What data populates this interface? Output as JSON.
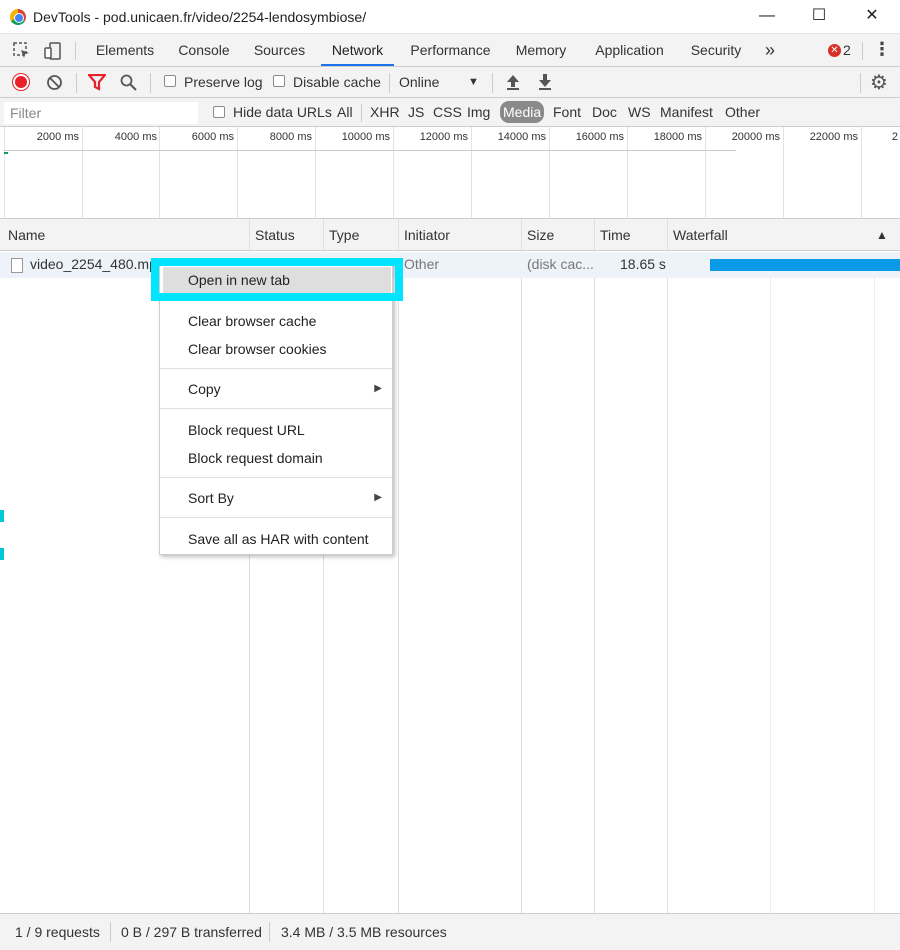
{
  "window": {
    "title": "DevTools - pod.unicaen.fr/video/2254-lendosymbiose/",
    "minimize_glyph": "—",
    "maximize_glyph": "☐",
    "close_glyph": "✕"
  },
  "tabs": {
    "items": [
      "Elements",
      "Console",
      "Sources",
      "Network",
      "Performance",
      "Memory",
      "Application",
      "Security"
    ],
    "active": "Network",
    "more_glyph": "»",
    "error_count": "2"
  },
  "toolbar": {
    "preserve_log": "Preserve log",
    "disable_cache": "Disable cache",
    "throttle": "Online",
    "throttle_arrow": "▼"
  },
  "filterbar": {
    "placeholder": "Filter",
    "hide_data_urls": "Hide data URLs",
    "types": [
      "All",
      "XHR",
      "JS",
      "CSS",
      "Img",
      "Media",
      "Font",
      "Doc",
      "WS",
      "Manifest",
      "Other"
    ],
    "active_type": "Media"
  },
  "overview": {
    "ticks": [
      "2000 ms",
      "4000 ms",
      "6000 ms",
      "8000 ms",
      "10000 ms",
      "12000 ms",
      "14000 ms",
      "16000 ms",
      "18000 ms",
      "20000 ms",
      "22000 ms",
      "2"
    ]
  },
  "table": {
    "columns": [
      "Name",
      "Status",
      "Type",
      "Initiator",
      "Size",
      "Time",
      "Waterfall"
    ],
    "sort_glyph": "▲",
    "rows": [
      {
        "name": "video_2254_480.mp",
        "initiator": "Other",
        "size": "(disk cac...",
        "time": "18.65 s"
      }
    ]
  },
  "context_menu": {
    "open_new_tab": "Open in new tab",
    "clear_cache": "Clear browser cache",
    "clear_cookies": "Clear browser cookies",
    "copy": "Copy",
    "block_url": "Block request URL",
    "block_domain": "Block request domain",
    "sort_by": "Sort By",
    "save_har": "Save all as HAR with content",
    "submenu_glyph": "▶"
  },
  "status": {
    "requests": "1 / 9 requests",
    "transferred": "0 B / 297 B transferred",
    "resources": "3.4 MB / 3.5 MB resources"
  },
  "colors": {
    "accent": "#1a73e8",
    "record": "#e8202a",
    "filter_active": "#e8202a",
    "waterfall": "#0b9be6",
    "highlight": "#00e5ff"
  }
}
